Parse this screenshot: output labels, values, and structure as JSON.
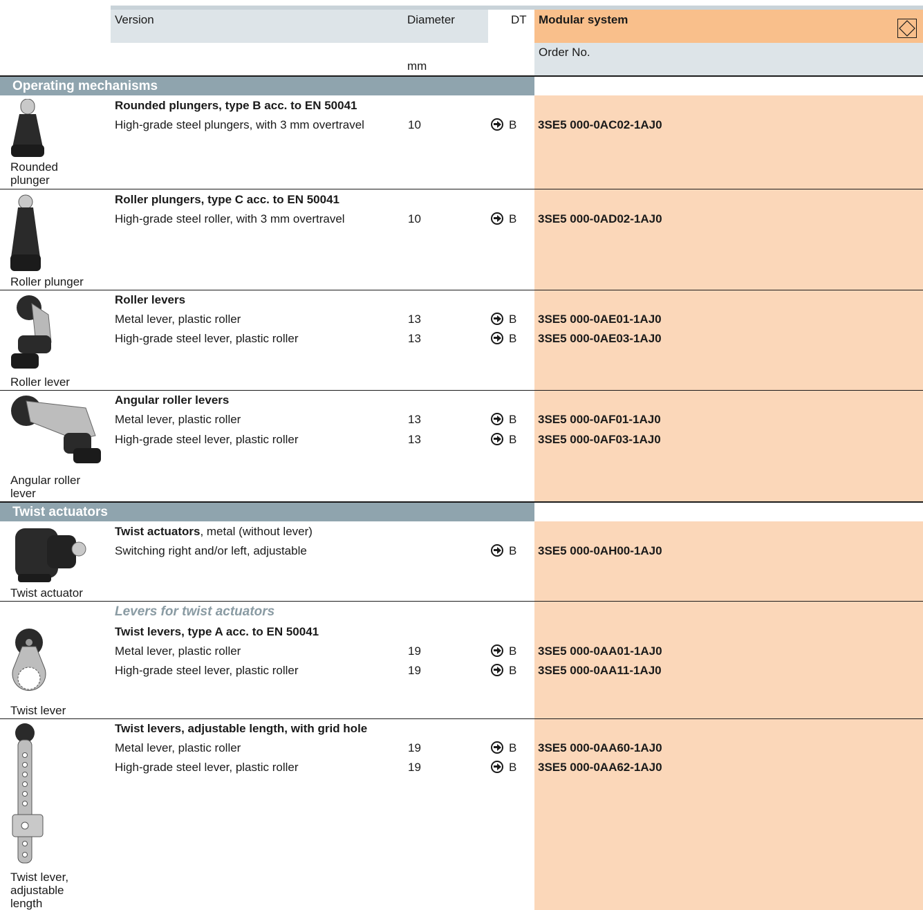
{
  "header": {
    "version": "Version",
    "diameter": "Diameter",
    "dt": "DT",
    "modular": "Modular system",
    "order_no": "Order No.",
    "unit": "mm"
  },
  "sections": {
    "operating": "Operating mechanisms",
    "twist": "Twist actuators"
  },
  "groups": [
    {
      "caption": "Rounded plunger",
      "title": "Rounded plungers, type B acc. to EN 50041",
      "rows": [
        {
          "desc": "High-grade steel plungers, with 3 mm overtravel",
          "dia": "10",
          "dt": "B",
          "order": "3SE5 000-0AC02-1AJ0"
        }
      ]
    },
    {
      "caption": "Roller plunger",
      "title": "Roller plungers, type C acc. to EN 50041",
      "rows": [
        {
          "desc": "High-grade steel roller, with 3 mm overtravel",
          "dia": "10",
          "dt": "B",
          "order": "3SE5 000-0AD02-1AJ0"
        }
      ]
    },
    {
      "caption": "Roller lever",
      "title": "Roller levers",
      "rows": [
        {
          "desc": "Metal lever, plastic roller",
          "dia": "13",
          "dt": "B",
          "order": "3SE5 000-0AE01-1AJ0"
        },
        {
          "desc": "High-grade steel lever, plastic roller",
          "dia": "13",
          "dt": "B",
          "order": "3SE5 000-0AE03-1AJ0"
        }
      ]
    },
    {
      "caption": "Angular roller lever",
      "title": "Angular roller levers",
      "rows": [
        {
          "desc": "Metal lever, plastic roller",
          "dia": "13",
          "dt": "B",
          "order": "3SE5 000-0AF01-1AJ0"
        },
        {
          "desc": "High-grade steel lever, plastic roller",
          "dia": "13",
          "dt": "B",
          "order": "3SE5 000-0AF03-1AJ0"
        }
      ]
    },
    {
      "caption": "Twist actuator",
      "title": "Twist actuators",
      "title_suffix": ", metal (without lever)",
      "rows": [
        {
          "desc": "Switching right and/or left, adjustable",
          "dia": "",
          "dt": "B",
          "order": "3SE5 000-0AH00-1AJ0"
        }
      ]
    },
    {
      "caption": "Twist lever",
      "subheading": "Levers for twist actuators",
      "title": "Twist levers, type A acc. to EN 50041",
      "rows": [
        {
          "desc": "Metal lever, plastic roller",
          "dia": "19",
          "dt": "B",
          "order": "3SE5 000-0AA01-1AJ0"
        },
        {
          "desc": "High-grade steel lever, plastic roller",
          "dia": "19",
          "dt": "B",
          "order": "3SE5 000-0AA11-1AJ0"
        }
      ]
    },
    {
      "caption": "Twist lever, adjustable length",
      "title": "Twist levers, adjustable length, with grid hole",
      "rows": [
        {
          "desc": "Metal lever, plastic roller",
          "dia": "19",
          "dt": "B",
          "order": "3SE5 000-0AA60-1AJ0"
        },
        {
          "desc": "High-grade steel lever, plastic roller",
          "dia": "19",
          "dt": "B",
          "order": "3SE5 000-0AA62-1AJ0"
        }
      ]
    }
  ]
}
